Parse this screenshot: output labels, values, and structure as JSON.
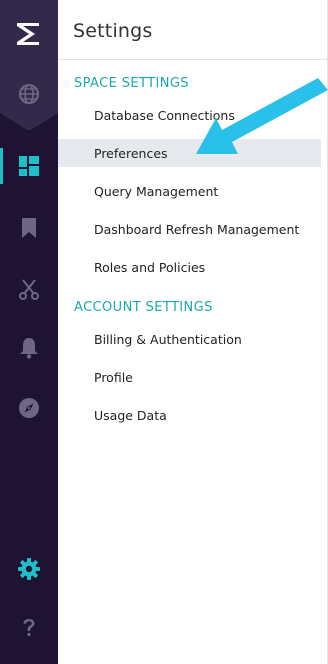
{
  "colors": {
    "rail_background": "#1e1333",
    "rail_logo_block": "#33294a",
    "rail_icon": "#6f6685",
    "accent_teal": "#1fbfc9",
    "section_heading": "#1aa8a8",
    "selected_row": "#e6e9ee",
    "annotation_arrow": "#29c1ea"
  },
  "rail": {
    "logo_icon": "periscope-logo-icon",
    "items": [
      {
        "name": "globe",
        "icon": "globe-icon",
        "active": false
      },
      {
        "name": "dashboards",
        "icon": "dashboard-grid-icon",
        "active": true
      },
      {
        "name": "bookmarks",
        "icon": "bookmark-icon",
        "active": false
      },
      {
        "name": "scissors",
        "icon": "scissors-icon",
        "active": false
      },
      {
        "name": "notifications",
        "icon": "bell-icon",
        "active": false
      },
      {
        "name": "discover",
        "icon": "compass-icon",
        "active": false
      },
      {
        "name": "settings",
        "icon": "gear-icon",
        "active": true
      },
      {
        "name": "help",
        "icon": "question-icon",
        "active": false
      }
    ]
  },
  "panel": {
    "title": "Settings",
    "sections": [
      {
        "heading": "SPACE SETTINGS",
        "items": [
          {
            "label": "Database Connections",
            "selected": false
          },
          {
            "label": "Preferences",
            "selected": true
          },
          {
            "label": "Query Management",
            "selected": false
          },
          {
            "label": "Dashboard Refresh Management",
            "selected": false
          },
          {
            "label": "Roles and Policies",
            "selected": false
          }
        ]
      },
      {
        "heading": "ACCOUNT SETTINGS",
        "items": [
          {
            "label": "Billing & Authentication",
            "selected": false
          },
          {
            "label": "Profile",
            "selected": false
          },
          {
            "label": "Usage Data",
            "selected": false
          }
        ]
      }
    ]
  },
  "annotation": {
    "icon": "arrow-pointer-icon",
    "points_to": "Preferences"
  }
}
